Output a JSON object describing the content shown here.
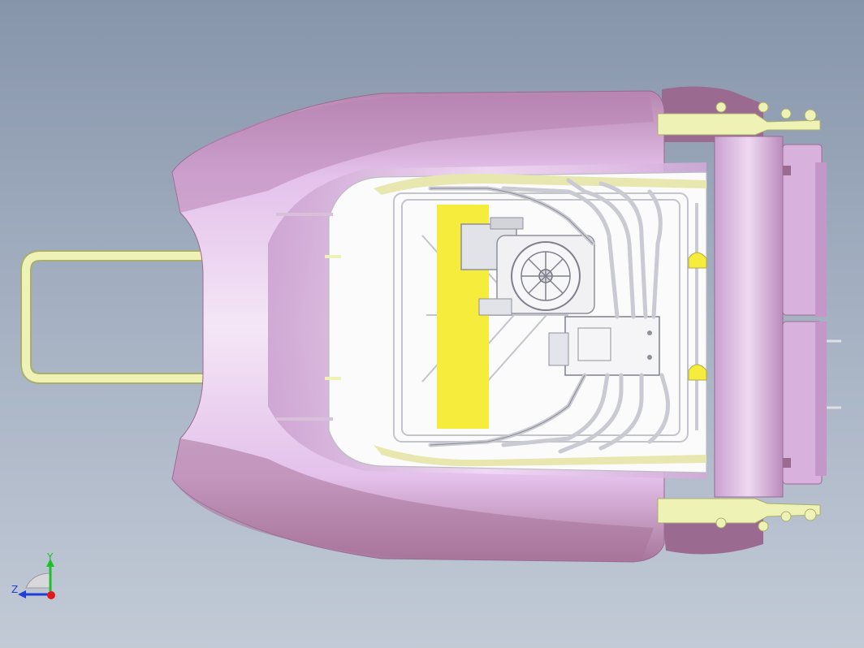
{
  "viewport": {
    "background_top": "#8795ab",
    "background_bottom": "#c2cad6"
  },
  "model": {
    "body_color": "#d6a6e0",
    "body_shadow": "#a8769b",
    "body_highlight": "#f6ecf7",
    "handle_color": "#eef3b5",
    "handle_stroke": "#a9ae6e",
    "panel_yellow": "#f5ec3c",
    "interior_color": "#fbfbfb",
    "pipe_color": "#c9cad2",
    "accent_orange": "#e78a1a"
  },
  "triad": {
    "y_label": "Y",
    "z_label": "Z",
    "y_color": "#1fbf2a",
    "z_color": "#1f3fd6",
    "x_color": "#e01a1a"
  }
}
